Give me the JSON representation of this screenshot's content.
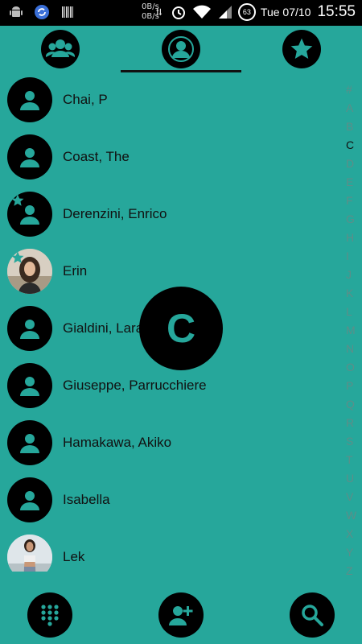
{
  "status_bar": {
    "net_speed_up": "0B/s",
    "net_speed_down": "0B/s",
    "battery_level": "63",
    "date": "Tue 07/10",
    "time": "15:55",
    "icons": [
      "android-icon",
      "sync-icon",
      "barcode-icon",
      "data-arrows-icon",
      "alarm-icon",
      "wifi-icon",
      "signal-icon",
      "battery-icon"
    ]
  },
  "tabs": [
    {
      "name": "groups",
      "icon": "groups-icon",
      "selected": false
    },
    {
      "name": "contacts",
      "icon": "person-icon",
      "selected": true
    },
    {
      "name": "favorites",
      "icon": "star-icon",
      "selected": false
    }
  ],
  "contacts": [
    {
      "name": "Chai, P",
      "avatar": "default",
      "starred": false
    },
    {
      "name": "Coast, The",
      "avatar": "default",
      "starred": false
    },
    {
      "name": "Derenzini, Enrico",
      "avatar": "default",
      "starred": true
    },
    {
      "name": "Erin",
      "avatar": "photo",
      "starred": true
    },
    {
      "name": "Gialdini, Lara",
      "avatar": "default",
      "starred": false
    },
    {
      "name": "Giuseppe, Parrucchiere",
      "avatar": "default",
      "starred": false
    },
    {
      "name": "Hamakawa, Akiko",
      "avatar": "default",
      "starred": false
    },
    {
      "name": "Isabella",
      "avatar": "default",
      "starred": false
    },
    {
      "name": "Lek",
      "avatar": "photo",
      "starred": false
    }
  ],
  "alphabet_index": [
    "#",
    "A",
    "B",
    "C",
    "D",
    "E",
    "F",
    "G",
    "H",
    "I",
    "J",
    "K",
    "L",
    "M",
    "N",
    "O",
    "P",
    "Q",
    "R",
    "S",
    "T",
    "U",
    "V",
    "W",
    "X",
    "Y",
    "Z"
  ],
  "alphabet_active": "C",
  "scroll_bubble_letter": "C",
  "bottom_bar": {
    "dialpad_icon": "dialpad-icon",
    "add_contact_icon": "add-person-icon",
    "search_icon": "search-icon"
  },
  "colors": {
    "background": "#26a79b",
    "accent_dark": "#000000",
    "icon_teal": "#26a79b"
  }
}
